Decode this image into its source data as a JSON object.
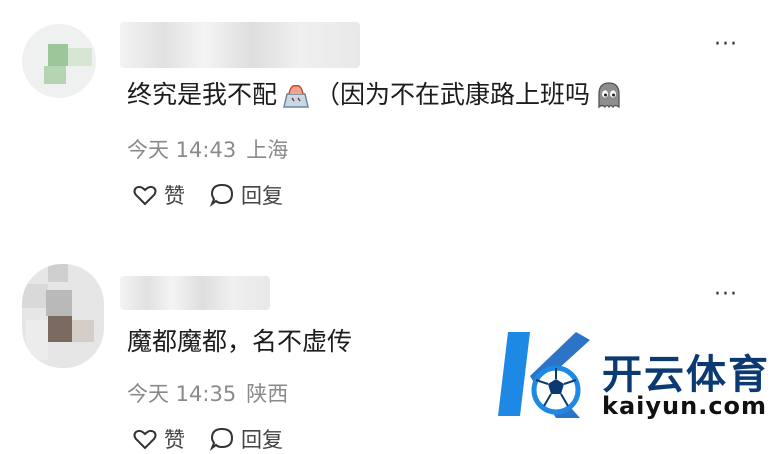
{
  "comments": [
    {
      "text_before_emoji": "终究是我不配",
      "text_after_emoji": "（因为不在武康路上班吗",
      "time": "今天 14:43",
      "location": "上海",
      "like_label": "赞",
      "reply_label": "回复",
      "more": "···"
    },
    {
      "text": "魔都魔都，名不虚传",
      "time": "今天 14:35",
      "location": "陕西",
      "like_label": "赞",
      "reply_label": "回复",
      "more": "···"
    }
  ],
  "watermark": {
    "brand": "开云体育",
    "url": "kaiyun.com"
  },
  "colors": {
    "text": "#1c1c1c",
    "meta": "#8a8a8a",
    "brand_blue": "#1e88e5",
    "brand_dark": "#0b3a72"
  }
}
